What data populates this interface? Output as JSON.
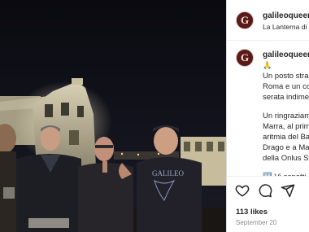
{
  "post": {
    "account": {
      "username": "galileoqueen",
      "avatar_letter": "G",
      "location": "La Lanterna di F"
    },
    "caption": {
      "username": "galileoqueen",
      "emoji": "🙏",
      "lines": [
        "Un posto stra",
        "Roma e un co",
        "serata indime"
      ],
      "lines2": [
        "Un ringraziam",
        "Marra, al prim",
        "aritmia del Ba",
        "Drago e a Ma",
        "della Onlus St"
      ],
      "partial_line": "🔠 Vi aspetti"
    },
    "likes": "113 likes",
    "date": "September 20",
    "photo_text": {
      "shirt_text": "GALILEO"
    },
    "colors": {
      "text": "#262626",
      "muted": "#8e8e8e",
      "avatar_bg": "#5a1a1a",
      "sky": "#0c0c12"
    },
    "icons": [
      "heart-icon",
      "comment-icon",
      "share-icon"
    ]
  }
}
